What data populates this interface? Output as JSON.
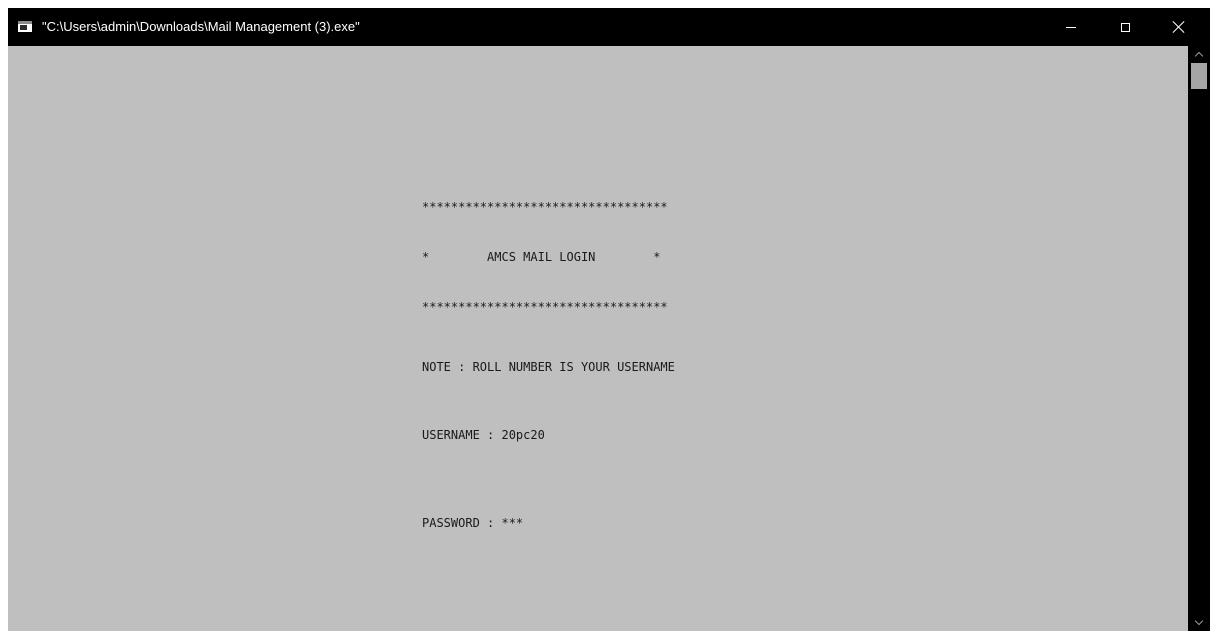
{
  "window": {
    "title": "\"C:\\Users\\admin\\Downloads\\Mail Management (3).exe\"",
    "icon": "console-app-icon",
    "controls": {
      "minimize": "minimize-icon",
      "maximize": "maximize-icon",
      "close": "close-icon"
    }
  },
  "console": {
    "banner_top": "**********************************",
    "banner_title": "*        AMCS MAIL LOGIN        *",
    "banner_bottom": "**********************************",
    "note": "NOTE : ROLL NUMBER IS YOUR USERNAME",
    "username_prompt": "USERNAME : 20pc20",
    "password_prompt": "PASSWORD : ***"
  },
  "colors": {
    "console_background": "#bfbfbf",
    "console_text": "#1a1a1a",
    "titlebar": "#000000",
    "scrollbar_track": "#000000",
    "scrollbar_thumb": "#a6a6a6"
  }
}
